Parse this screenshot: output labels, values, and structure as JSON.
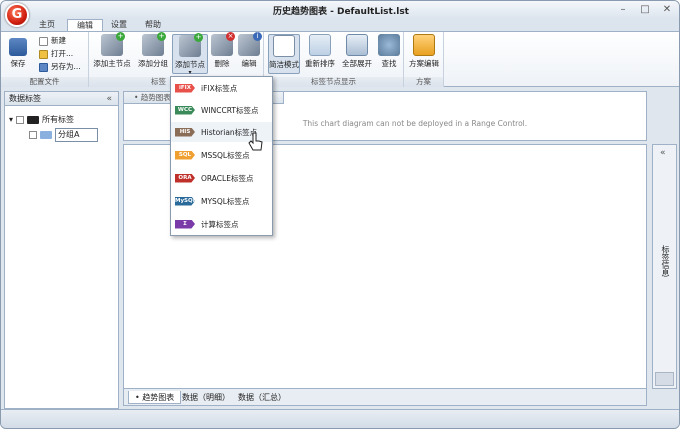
{
  "window": {
    "title": "历史趋势图表 - DefaultList.lst",
    "logo_letter": "G",
    "controls": {
      "minimize": "–",
      "maximize": "□",
      "close": "✕"
    }
  },
  "ribbon_tabs": [
    "主页",
    "编辑",
    "设置",
    "帮助"
  ],
  "ribbon": {
    "groups": {
      "config_file": "配置文件",
      "tag": "标签",
      "tag_node_display": "标签节点显示",
      "scheme": "方案"
    },
    "buttons": {
      "save": "保存",
      "new": "新建",
      "open": "打开...",
      "save_as": "另存为...",
      "add_main_node": "添加主节点",
      "add_group": "添加分组",
      "add_node": "添加节点",
      "delete": "删除",
      "edit": "编辑",
      "simple_mode": "简洁模式",
      "resort": "重新排序",
      "expand_all": "全部展开",
      "find": "查找",
      "scheme_edit": "方案编辑"
    }
  },
  "add_node_menu": [
    {
      "badge": "iFIX",
      "label": "iFIX标签点",
      "color": "#e8504a"
    },
    {
      "badge": "WCC",
      "label": "WINCCRT标签点",
      "color": "#3b8a5a"
    },
    {
      "badge": "HIS",
      "label": "Historian标签点",
      "color": "#8a6e58"
    },
    {
      "badge": "SQL",
      "label": "MSSQL标签点",
      "color": "#f0a030"
    },
    {
      "badge": "ORA",
      "label": "ORACLE标签点",
      "color": "#c0302a"
    },
    {
      "badge": "MySQL",
      "label": "MYSQL标签点",
      "color": "#2a6a9a"
    },
    {
      "badge": "Σ",
      "label": "计算标签点",
      "color": "#7a3aa8"
    }
  ],
  "left_panel": {
    "title": "数据标签",
    "collapse": "«",
    "tree": [
      {
        "label": "所有标签",
        "expander": "▾"
      },
      {
        "label": "分组A"
      }
    ]
  },
  "chart_panel": {
    "tab": "• 趋势图表",
    "message": "This chart diagram can not be deployed in a Range Control."
  },
  "bottom_tabs": [
    "• 趋势图表",
    "数据（明细）",
    "数据（汇总）"
  ],
  "right_panel": {
    "collapse": "«",
    "label": "标签信息"
  }
}
